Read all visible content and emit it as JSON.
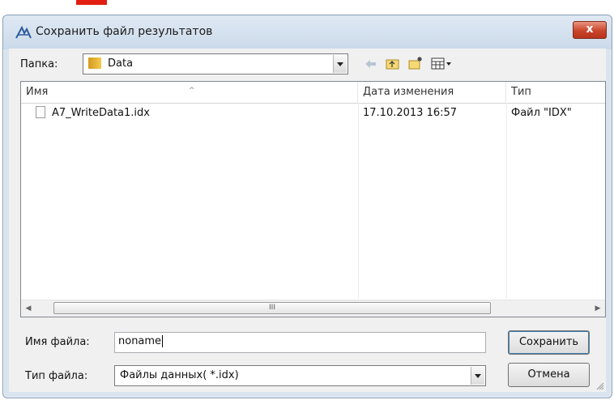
{
  "window": {
    "title": "Сохранить файл результатов",
    "close_label": "x"
  },
  "folder": {
    "label": "Папка:",
    "value": "Data"
  },
  "list": {
    "columns": [
      "Имя",
      "Дата изменения",
      "Тип"
    ],
    "rows": [
      {
        "name": "A7_WriteData1.idx",
        "date": "17.10.2013 16:57",
        "type": "Файл \"IDX\""
      }
    ],
    "scroll_thumb_label": "III"
  },
  "filename": {
    "label": "Имя файла:",
    "value": "noname"
  },
  "filetype": {
    "label": "Тип файла:",
    "value": "Файлы данных( *.idx)"
  },
  "buttons": {
    "save": "Сохранить",
    "cancel": "Отмена"
  },
  "icons": {
    "back": "back-arrow-icon",
    "up": "up-folder-icon",
    "new_folder": "new-folder-icon",
    "view_menu": "view-menu-icon"
  }
}
